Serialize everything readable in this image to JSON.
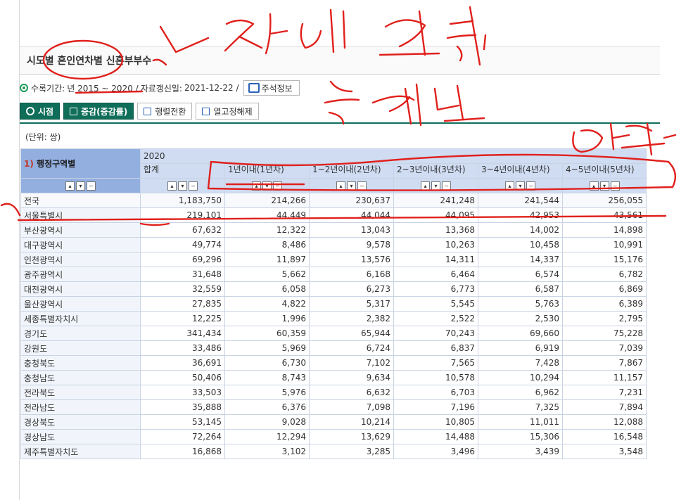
{
  "page": {
    "title": "시도별 혼인연차별 신혼부부수",
    "info": {
      "period_label": "수록기간:",
      "period_value": "년 2015 ~ 2020 /",
      "updated_label": "자료갱신일:",
      "updated_value": "2021-12-22 /",
      "note_button": "주석정보"
    },
    "toolbar": {
      "view_button": "시점",
      "change_button": "증감(증감률)",
      "transpose_button": "행렬전환",
      "unfix_button": "열고정해제"
    },
    "unit": "(단위: 쌍)"
  },
  "table": {
    "row_header_num": "1)",
    "row_header": "행정구역별",
    "year": "2020",
    "columns": [
      "합계",
      "1년이내(1년차)",
      "1~2년이내(2년차)",
      "2~3년이내(3년차)",
      "3~4년이내(4년차)",
      "4~5년이내(5년차)"
    ],
    "rows": [
      {
        "name": "전국",
        "values": [
          "1,183,750",
          "214,266",
          "230,637",
          "241,248",
          "241,544",
          "256,055"
        ]
      },
      {
        "name": "서울특별시",
        "values": [
          "219,101",
          "44,449",
          "44,044",
          "44,095",
          "42,953",
          "43,561"
        ]
      },
      {
        "name": "부산광역시",
        "values": [
          "67,632",
          "12,322",
          "13,043",
          "13,368",
          "14,002",
          "14,898"
        ]
      },
      {
        "name": "대구광역시",
        "values": [
          "49,774",
          "8,486",
          "9,578",
          "10,263",
          "10,458",
          "10,991"
        ]
      },
      {
        "name": "인천광역시",
        "values": [
          "69,296",
          "11,897",
          "13,576",
          "14,311",
          "14,337",
          "15,176"
        ]
      },
      {
        "name": "광주광역시",
        "values": [
          "31,648",
          "5,662",
          "6,168",
          "6,464",
          "6,574",
          "6,782"
        ]
      },
      {
        "name": "대전광역시",
        "values": [
          "32,559",
          "6,058",
          "6,273",
          "6,773",
          "6,587",
          "6,869"
        ]
      },
      {
        "name": "울산광역시",
        "values": [
          "27,835",
          "4,822",
          "5,317",
          "5,545",
          "5,763",
          "6,389"
        ]
      },
      {
        "name": "세종특별자치시",
        "values": [
          "12,225",
          "1,996",
          "2,382",
          "2,522",
          "2,530",
          "2,795"
        ]
      },
      {
        "name": "경기도",
        "values": [
          "341,434",
          "60,359",
          "65,944",
          "70,243",
          "69,660",
          "75,228"
        ]
      },
      {
        "name": "강원도",
        "values": [
          "33,486",
          "5,969",
          "6,724",
          "6,837",
          "6,919",
          "7,039"
        ]
      },
      {
        "name": "충청북도",
        "values": [
          "36,691",
          "6,730",
          "7,102",
          "7,565",
          "7,428",
          "7,867"
        ]
      },
      {
        "name": "충청남도",
        "values": [
          "50,406",
          "8,743",
          "9,634",
          "10,578",
          "10,294",
          "11,157"
        ]
      },
      {
        "name": "전라북도",
        "values": [
          "33,503",
          "5,976",
          "6,632",
          "6,703",
          "6,962",
          "7,231"
        ]
      },
      {
        "name": "전라남도",
        "values": [
          "35,888",
          "6,376",
          "7,098",
          "7,196",
          "7,325",
          "7,894"
        ]
      },
      {
        "name": "경상북도",
        "values": [
          "53,145",
          "9,028",
          "10,214",
          "10,805",
          "11,011",
          "12,088"
        ]
      },
      {
        "name": "경상남도",
        "values": [
          "72,264",
          "12,294",
          "13,629",
          "14,488",
          "15,306",
          "16,548"
        ]
      },
      {
        "name": "제주특별자치도",
        "values": [
          "16,868",
          "3,102",
          "3,285",
          "3,496",
          "3,439",
          "3,548"
        ]
      }
    ]
  },
  "colors": {
    "accent_green": "#0f6e5a",
    "header_blue": "#cfdcf2",
    "row_header_blue": "#93afe0",
    "annotation_red": "#e0201c"
  }
}
